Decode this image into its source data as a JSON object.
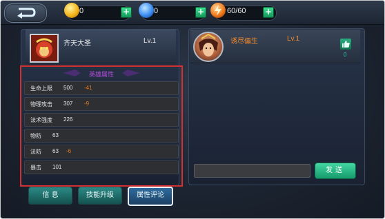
{
  "topbar": {
    "back_icon": "back-arrow-icon",
    "gold": {
      "icon": "gold-coin-icon",
      "value": "0",
      "color": "#f3b51b"
    },
    "gems": {
      "icon": "blue-gem-icon",
      "value": "0",
      "color": "#3b8df0"
    },
    "stamina": {
      "icon": "lightning-icon",
      "value": "60/60",
      "color": "#f07a1a"
    },
    "plus_label": "+"
  },
  "hero": {
    "name": "齐天大圣",
    "level": "Lv.1",
    "portrait_icon": "monkey-king-portrait"
  },
  "stats": {
    "title": "英雄属性",
    "rows": [
      {
        "label": "生命上限",
        "value": "500",
        "delta": "-41"
      },
      {
        "label": "物理攻击",
        "value": "307",
        "delta": "-9"
      },
      {
        "label": "法术强度",
        "value": "226",
        "delta": ""
      },
      {
        "label": "物防",
        "value": "63",
        "delta": ""
      },
      {
        "label": "法防",
        "value": "63",
        "delta": "-6"
      },
      {
        "label": "暴击",
        "value": "101",
        "delta": ""
      }
    ]
  },
  "tabs": [
    {
      "label": "信 息"
    },
    {
      "label": "技能升级"
    },
    {
      "label": "属性评论"
    }
  ],
  "comment": {
    "user": "诱尽儡生",
    "level": "Lv.1",
    "like_count": "0",
    "like_icon": "thumbs-up-icon",
    "avatar_icon": "female-hero-avatar"
  },
  "send_label": "发送"
}
